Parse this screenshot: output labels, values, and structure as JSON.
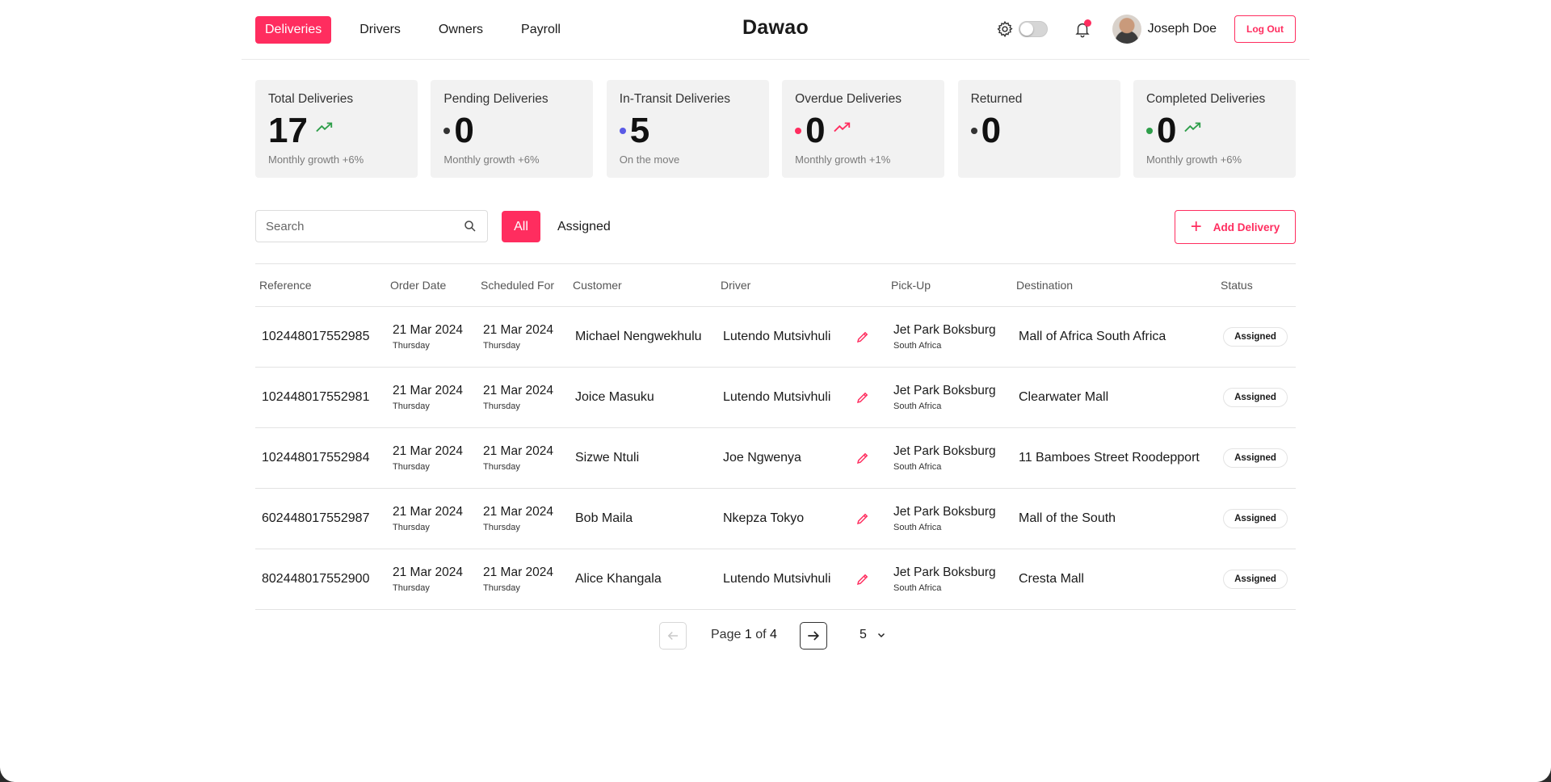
{
  "nav": {
    "tabs": [
      {
        "label": "Deliveries",
        "active": true
      },
      {
        "label": "Drivers",
        "active": false
      },
      {
        "label": "Owners",
        "active": false
      },
      {
        "label": "Payroll",
        "active": false
      }
    ],
    "brand": "Dawao",
    "user_name": "Joseph Doe",
    "logout_label": "Log Out",
    "theme_toggle_on": false,
    "has_notification": true
  },
  "stats": [
    {
      "title": "Total Deliveries",
      "value": "17",
      "dot_color": "",
      "trend": "up",
      "trend_color": "#2e9e4a",
      "sub": "Monthly growth +6%"
    },
    {
      "title": "Pending Deliveries",
      "value": "0",
      "dot_color": "#333333",
      "trend": "",
      "trend_color": "",
      "sub": "Monthly growth +6%"
    },
    {
      "title": "In-Transit Deliveries",
      "value": "5",
      "dot_color": "#5a5ae6",
      "trend": "",
      "trend_color": "",
      "sub": "On the move"
    },
    {
      "title": "Overdue Deliveries",
      "value": "0",
      "dot_color": "#ff2d5f",
      "trend": "up",
      "trend_color": "#ff2d5f",
      "sub": "Monthly growth +1%"
    },
    {
      "title": "Returned",
      "value": "0",
      "dot_color": "#333333",
      "trend": "",
      "trend_color": "",
      "sub": ""
    },
    {
      "title": "Completed Deliveries",
      "value": "0",
      "dot_color": "#2e9e4a",
      "trend": "up",
      "trend_color": "#2e9e4a",
      "sub": "Monthly growth +6%"
    }
  ],
  "toolbar": {
    "search_placeholder": "Search",
    "filter_all": "All",
    "filter_assigned": "Assigned",
    "add_label": "Add Delivery"
  },
  "table": {
    "headers": [
      "Reference",
      "Order Date",
      "Scheduled For",
      "Customer",
      "Driver",
      "Pick-Up",
      "Destination",
      "Status"
    ],
    "rows": [
      {
        "ref": "102448017552985",
        "order_date": "21 Mar 2024",
        "order_day": "Thursday",
        "sched_date": "21 Mar 2024",
        "sched_day": "Thursday",
        "customer": "Michael Nengwekhulu",
        "driver": "Lutendo Mutsivhuli",
        "pickup": "Jet Park Boksburg",
        "pickup_sub": "South Africa",
        "destination": "Mall of Africa South Africa",
        "status": "Assigned"
      },
      {
        "ref": "102448017552981",
        "order_date": "21 Mar 2024",
        "order_day": "Thursday",
        "sched_date": "21 Mar 2024",
        "sched_day": "Thursday",
        "customer": "Joice Masuku",
        "driver": "Lutendo Mutsivhuli",
        "pickup": "Jet Park Boksburg",
        "pickup_sub": "South Africa",
        "destination": "Clearwater Mall",
        "status": "Assigned"
      },
      {
        "ref": "102448017552984",
        "order_date": "21 Mar 2024",
        "order_day": "Thursday",
        "sched_date": "21 Mar 2024",
        "sched_day": "Thursday",
        "customer": "Sizwe Ntuli",
        "driver": "Joe Ngwenya",
        "pickup": "Jet Park Boksburg",
        "pickup_sub": "South Africa",
        "destination": "11 Bamboes Street Roodepport",
        "status": "Assigned"
      },
      {
        "ref": "602448017552987",
        "order_date": "21 Mar 2024",
        "order_day": "Thursday",
        "sched_date": "21 Mar 2024",
        "sched_day": "Thursday",
        "customer": "Bob Maila",
        "driver": "Nkepza Tokyo",
        "pickup": "Jet Park Boksburg",
        "pickup_sub": "South Africa",
        "destination": "Mall of the South",
        "status": "Assigned"
      },
      {
        "ref": "802448017552900",
        "order_date": "21 Mar 2024",
        "order_day": "Thursday",
        "sched_date": "21 Mar 2024",
        "sched_day": "Thursday",
        "customer": "Alice Khangala",
        "driver": "Lutendo Mutsivhuli",
        "pickup": "Jet Park Boksburg",
        "pickup_sub": "South Africa",
        "destination": "Cresta Mall",
        "status": "Assigned"
      }
    ]
  },
  "pagination": {
    "page_prefix": "Page",
    "current": "1",
    "of_label": "of",
    "total": "4",
    "page_size": "5"
  },
  "colors": {
    "accent": "#ff2d5f",
    "card_bg": "#f2f2f2"
  }
}
